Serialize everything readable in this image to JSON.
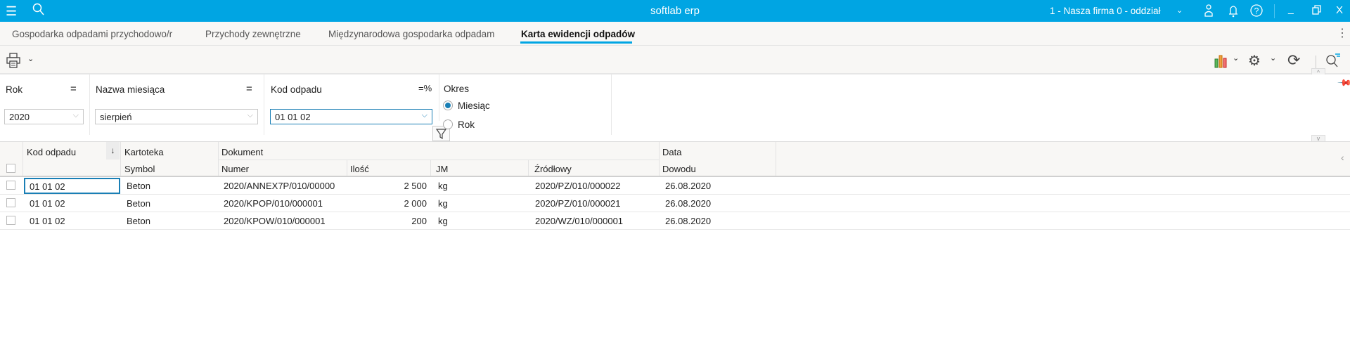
{
  "app": {
    "title": "softlab erp",
    "company": "1 - Nasza firma 0 - oddział"
  },
  "tabs": [
    {
      "label": "Gospodarka odpadami przychodowo/r",
      "active": false
    },
    {
      "label": "Przychody zewnętrzne",
      "active": false
    },
    {
      "label": "Międzynarodowa gospodarka odpadam",
      "active": false
    },
    {
      "label": "Karta ewidencji odpadów",
      "active": true
    }
  ],
  "filters": {
    "rok": {
      "label": "Rok",
      "op": "=",
      "value": "2020"
    },
    "miesiac": {
      "label": "Nazwa miesiąca",
      "op": "=",
      "value": "sierpień"
    },
    "kod": {
      "label": "Kod odpadu",
      "op": "=%",
      "value": "01 01 02"
    },
    "okres": {
      "label": "Okres",
      "options": [
        "Miesiąc",
        "Rok"
      ],
      "selected": "Miesiąc"
    }
  },
  "grid": {
    "headers": {
      "kod": "Kod odpadu",
      "kartoteka": "Kartoteka",
      "symbol": "Symbol",
      "dokument": "Dokument",
      "numer": "Numer",
      "ilosc": "Ilość",
      "jm": "JM",
      "zrodlowy": "Źródłowy",
      "data": "Data",
      "dowodu": "Dowodu"
    },
    "rows": [
      {
        "kod": "01 01 02",
        "symbol": "Beton",
        "numer": "2020/ANNEX7P/010/00000",
        "ilosc": "2 500",
        "jm": "kg",
        "zrodlowy": "2020/PZ/010/000022",
        "data": "26.08.2020"
      },
      {
        "kod": "01 01 02",
        "symbol": "Beton",
        "numer": "2020/KPOP/010/000001",
        "ilosc": "2 000",
        "jm": "kg",
        "zrodlowy": "2020/PZ/010/000021",
        "data": "26.08.2020"
      },
      {
        "kod": "01 01 02",
        "symbol": "Beton",
        "numer": "2020/KPOW/010/000001",
        "ilosc": "200",
        "jm": "kg",
        "zrodlowy": "2020/WZ/010/000001",
        "data": "26.08.2020"
      }
    ]
  },
  "colors": {
    "accent": "#00a5e3",
    "active_border": "#1a7fb5"
  }
}
